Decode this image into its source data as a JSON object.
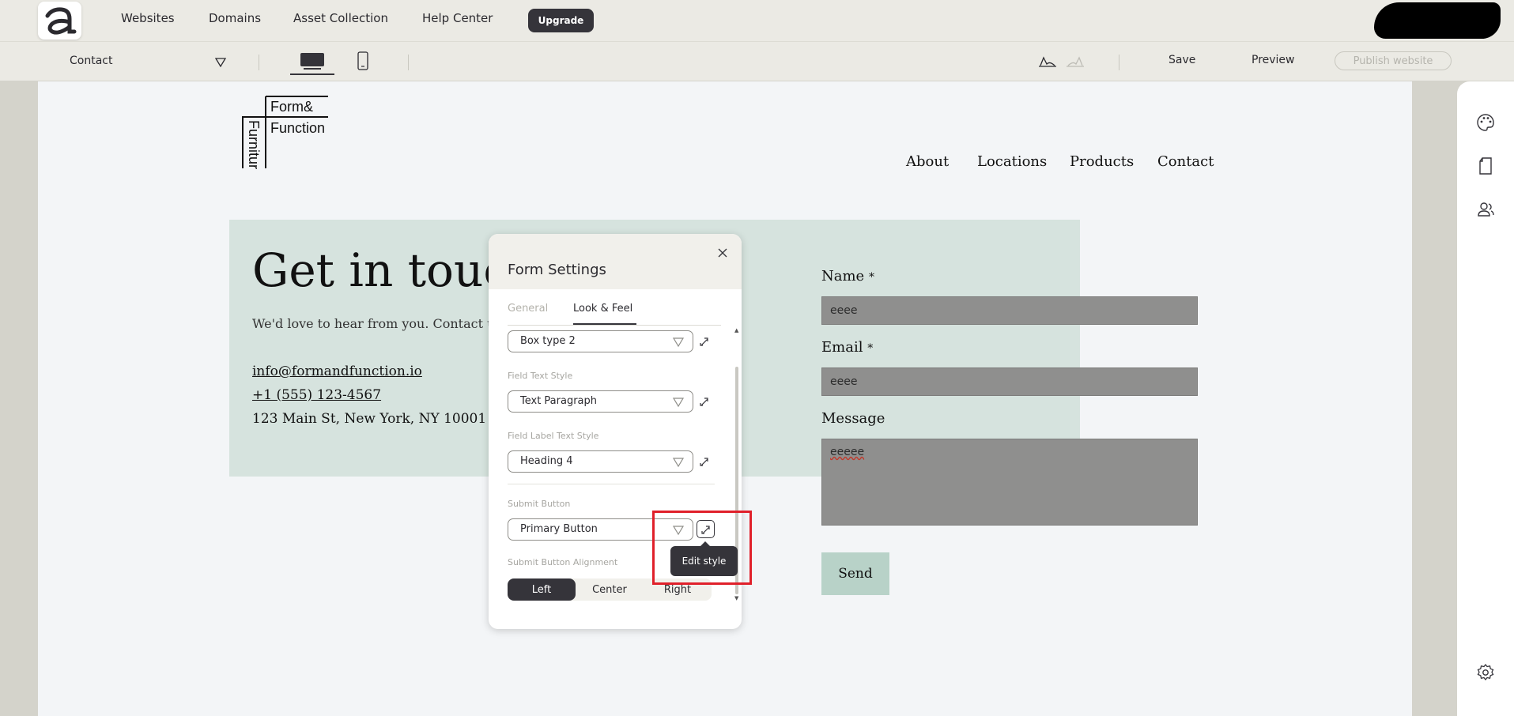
{
  "topnav": {
    "links": [
      "Websites",
      "Domains",
      "Asset Collection",
      "Help Center"
    ],
    "upgrade_label": "Upgrade"
  },
  "toolbar": {
    "page_name": "Contact",
    "save_label": "Save",
    "preview_label": "Preview",
    "publish_label": "Publish website"
  },
  "site": {
    "logo_lines": [
      "Form&",
      "Function",
      "Furniture"
    ],
    "nav": [
      "About",
      "Locations",
      "Products",
      "Contact"
    ],
    "hero_title": "Get in touc",
    "hero_subtitle": "We'd love to hear from you. Contact us too",
    "email": "info@formandfunction.io",
    "phone": "+1 (555) 123-4567",
    "address": "123 Main St, New York, NY 10001",
    "form": {
      "name_label": "Name",
      "email_label": "Email",
      "message_label": "Message",
      "required_mark": "*",
      "name_value": "eeee",
      "email_value": "eeee",
      "message_value": "eeeee",
      "send_label": "Send"
    }
  },
  "panel": {
    "title": "Form Settings",
    "tabs": [
      "General",
      "Look & Feel"
    ],
    "active_tab": "Look & Feel",
    "box_type_value": "Box type 2",
    "field_text_style_label": "Field Text Style",
    "field_text_style_value": "Text Paragraph",
    "field_label_style_label": "Field Label Text Style",
    "field_label_style_value": "Heading 4",
    "submit_button_label": "Submit Button",
    "submit_button_value": "Primary Button",
    "alignment_label": "Submit Button Alignment",
    "alignment_options": [
      "Left",
      "Center",
      "Right"
    ],
    "alignment_selected": "Left",
    "tooltip": "Edit style"
  },
  "colors": {
    "accent_dark": "#35343a",
    "hero_bg": "#d6e3de",
    "input_bg": "#8f8f8e",
    "send_bg": "#b8d2c8",
    "highlight": "#e0202a"
  }
}
